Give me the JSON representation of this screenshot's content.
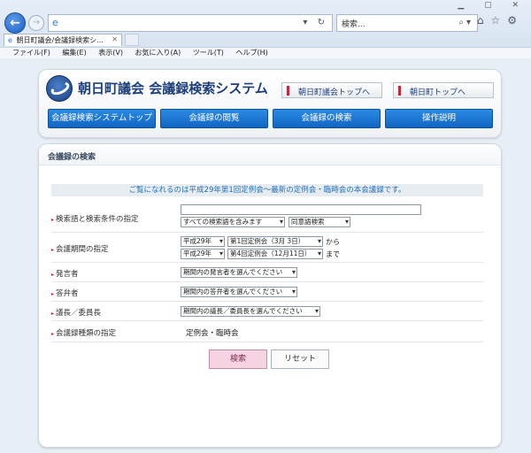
{
  "browser": {
    "search_placeholder": "検索...",
    "tab_title": "朝日町議会/会議録検索シ...",
    "menu": [
      "ファイル(F)",
      "編集(E)",
      "表示(V)",
      "お気に入り(A)",
      "ツール(T)",
      "ヘルプ(H)"
    ]
  },
  "header": {
    "title": "朝日町議会 会議録検索システム",
    "link1": "朝日町議会トップへ",
    "link2": "朝日町トップへ",
    "nav": [
      "会議録検索システムトップ",
      "会議録の閲覧",
      "会議録の検索",
      "操作説明"
    ]
  },
  "main": {
    "heading": "会議録の検索",
    "notice": "ご覧になれるのは平成29年第1回定例会〜最新の定例会・臨時会の本会議録です。",
    "keyword": {
      "label": "検索語と検索条件の指定",
      "value": "",
      "condition": "すべての検索語を含みます",
      "scope": "同意語検索"
    },
    "period": {
      "label": "会議期間の指定",
      "from_year": "平成29年",
      "from_session": "第1回定例会（3月 3日）",
      "from_suffix": "から",
      "to_year": "平成29年",
      "to_session": "第4回定例会（12月11日）",
      "to_suffix": "まで"
    },
    "speaker": {
      "label": "発言者",
      "value": "期間内の発言者を選んでください"
    },
    "respondent": {
      "label": "答弁者",
      "value": "期間内の答弁者を選んでください"
    },
    "chair": {
      "label": "議長／委員長",
      "value": "期間内の議長／委員長を選んでください"
    },
    "type": {
      "label": "会議録種類の指定",
      "value": "定例会・臨時会"
    },
    "search_button": "検索",
    "reset_button": "リセット"
  }
}
